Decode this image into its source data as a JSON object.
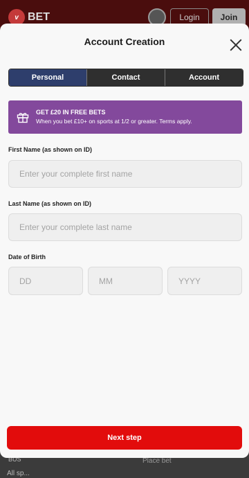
{
  "background": {
    "brand": "BET",
    "login_label": "Login",
    "join_label": "Join",
    "bottom_left_label": "BUS",
    "bottom_left_label_2": "All sp...",
    "bottom_center_label": "Place bet"
  },
  "modal": {
    "title": "Account Creation",
    "tabs": [
      {
        "label": "Personal",
        "active": true
      },
      {
        "label": "Contact",
        "active": false
      },
      {
        "label": "Account",
        "active": false
      }
    ],
    "promo": {
      "title": "GET £20 IN FREE BETS",
      "subtitle": "When you bet £10+ on sports at 1/2 or greater. Terms apply.",
      "icon": "gift-icon"
    },
    "first_name": {
      "label": "First Name (as shown on ID)",
      "placeholder": "Enter your complete first name",
      "value": ""
    },
    "last_name": {
      "label": "Last Name (as shown on ID)",
      "placeholder": "Enter your complete last name",
      "value": ""
    },
    "dob": {
      "label": "Date of Birth",
      "day_placeholder": "DD",
      "month_placeholder": "MM",
      "year_placeholder": "YYYY"
    },
    "next_label": "Next step"
  },
  "colors": {
    "active_tab": "#2e3e6c",
    "inactive_tab": "#2f2f2f",
    "promo_bg": "#83499c",
    "primary_button": "#e20c0c"
  }
}
